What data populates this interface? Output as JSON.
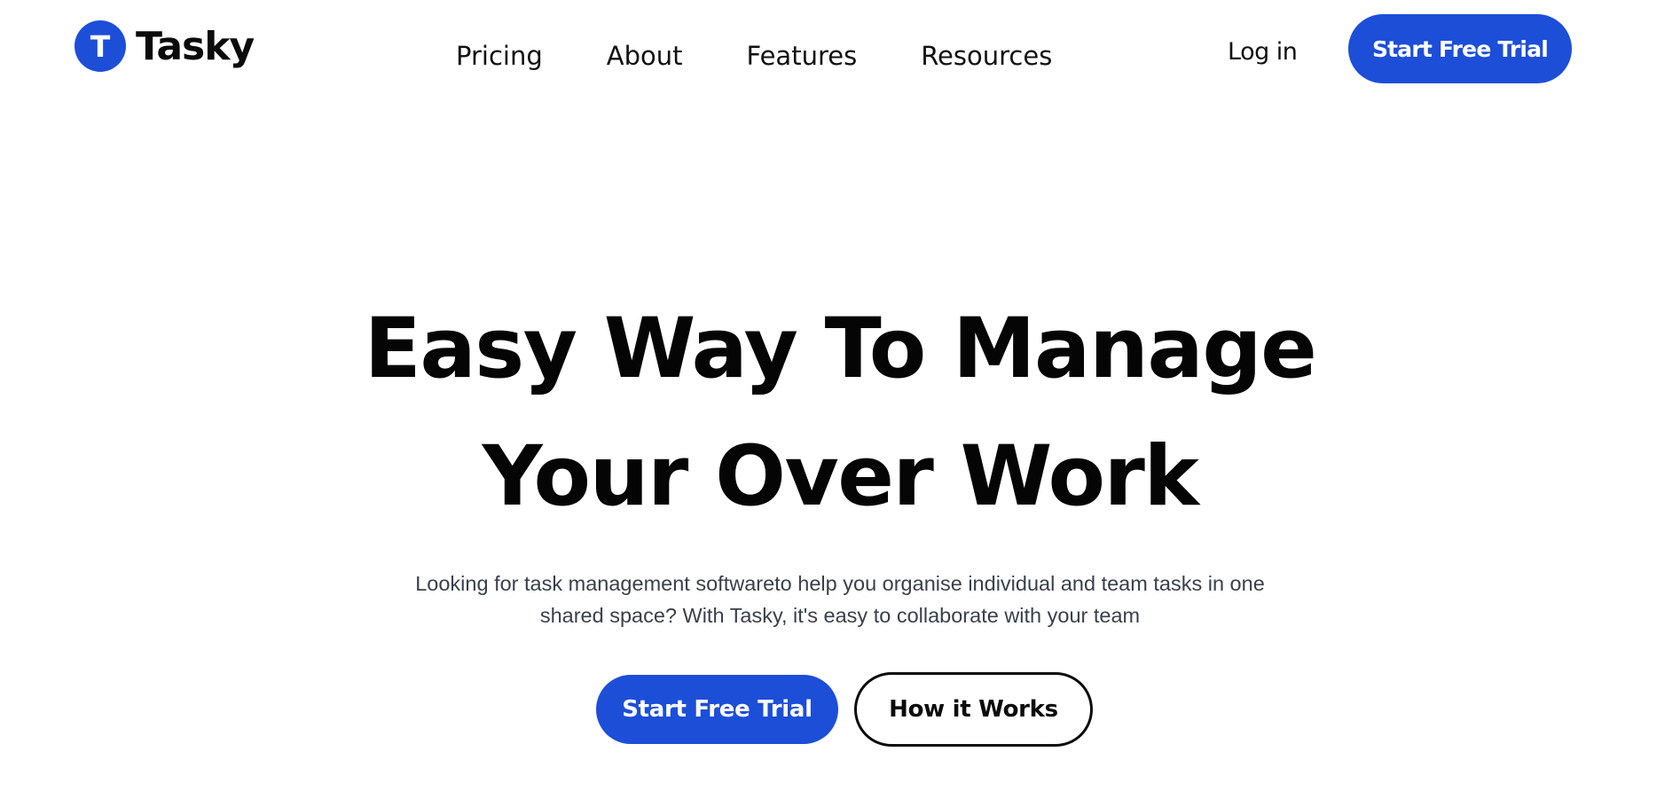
{
  "brand": {
    "logo_letter": "T",
    "name": "Tasky",
    "accent_color": "#1d4ed8"
  },
  "nav": {
    "items": [
      {
        "label": "Pricing"
      },
      {
        "label": "About"
      },
      {
        "label": "Features"
      },
      {
        "label": "Resources"
      }
    ]
  },
  "header": {
    "login_label": "Log in",
    "cta_label": "Start Free Trial"
  },
  "hero": {
    "title_line1": "Easy Way To Manage",
    "title_line2": "Your Over Work",
    "subtitle": "Looking for task management softwareto help you organise individual and team tasks in one shared space? With Tasky, it's easy to collaborate with your team",
    "primary_cta": "Start Free Trial",
    "secondary_cta": "How it Works"
  }
}
